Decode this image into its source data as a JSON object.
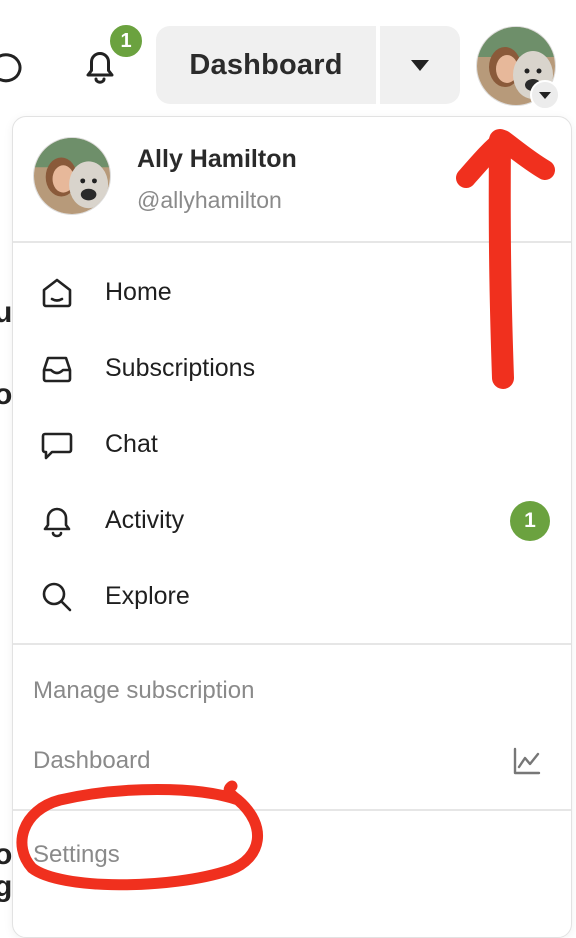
{
  "topbar": {
    "notification_count": "1",
    "dashboard_label": "Dashboard"
  },
  "profile": {
    "name": "Ally Hamilton",
    "handle": "@allyhamilton"
  },
  "menu": {
    "items": [
      {
        "label": "Home",
        "icon": "home-icon"
      },
      {
        "label": "Subscriptions",
        "icon": "inbox-icon"
      },
      {
        "label": "Chat",
        "icon": "chat-bubble-icon"
      },
      {
        "label": "Activity",
        "icon": "bell-icon",
        "badge": "1"
      },
      {
        "label": "Explore",
        "icon": "search-icon"
      }
    ],
    "manage_subscription": "Manage subscription",
    "dashboard": "Dashboard",
    "settings": "Settings"
  },
  "colors": {
    "badge_green": "#6ba23f",
    "annotation_red": "#f0301e"
  }
}
